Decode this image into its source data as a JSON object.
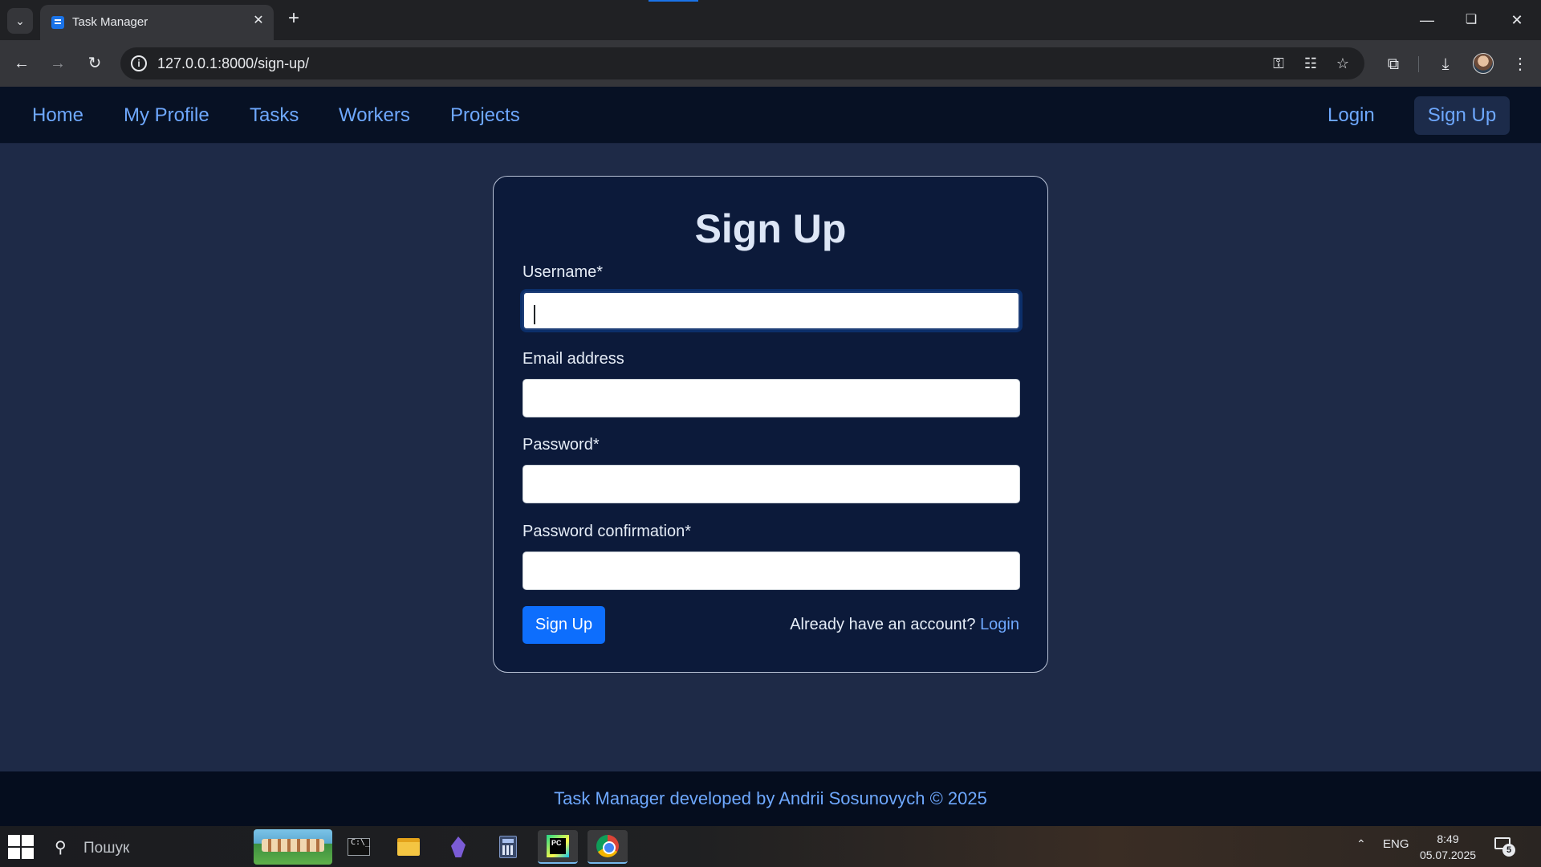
{
  "browser": {
    "tab_title": "Task Manager",
    "url": "127.0.0.1:8000/sign-up/"
  },
  "navbar": {
    "links": [
      "Home",
      "My Profile",
      "Tasks",
      "Workers",
      "Projects"
    ],
    "login": "Login",
    "signup": "Sign Up"
  },
  "form": {
    "title": "Sign Up",
    "fields": [
      {
        "label": "Username*",
        "value": ""
      },
      {
        "label": "Email address",
        "value": ""
      },
      {
        "label": "Password*",
        "value": ""
      },
      {
        "label": "Password confirmation*",
        "value": ""
      }
    ],
    "submit_label": "Sign Up",
    "login_prompt": "Already have an account?",
    "login_link": "Login"
  },
  "footer": {
    "text": "Task Manager developed by Andrii Sosunovych © 2025"
  },
  "taskbar": {
    "search_placeholder": "Пошук",
    "language": "ENG",
    "time": "8:49",
    "date": "05.07.2025",
    "notification_count": "5"
  },
  "colors": {
    "page_bg": "#1e2a47",
    "navbar_bg": "#071124",
    "card_bg": "#0c1a3a",
    "link": "#6ea8fe",
    "primary_button": "#0d6efd"
  }
}
